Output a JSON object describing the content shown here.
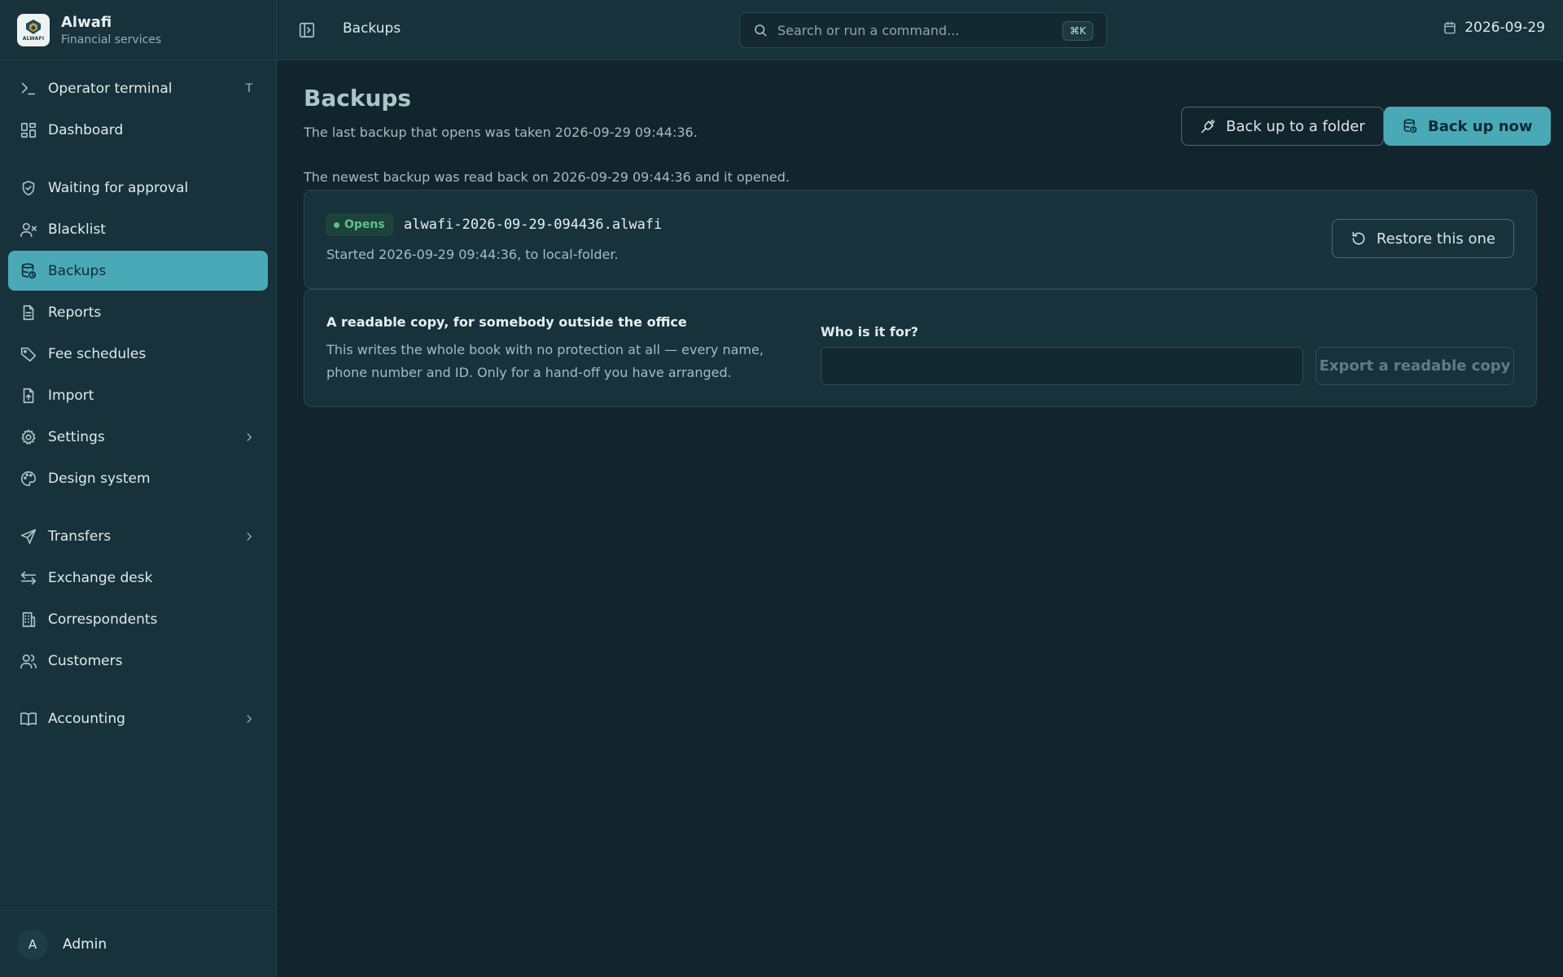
{
  "brand": {
    "name": "Alwafi",
    "subtitle": "Financial services",
    "logo_text": "ALWAFI"
  },
  "sidebar": {
    "groups": [
      [
        {
          "label": "Operator terminal",
          "icon": "terminal-icon",
          "shortcut": "T"
        },
        {
          "label": "Dashboard",
          "icon": "dashboard-icon"
        }
      ],
      [
        {
          "label": "Waiting for approval",
          "icon": "shield-check-icon"
        },
        {
          "label": "Blacklist",
          "icon": "user-x-icon"
        },
        {
          "label": "Backups",
          "icon": "database-backup-icon",
          "active": true
        },
        {
          "label": "Reports",
          "icon": "file-text-icon"
        },
        {
          "label": "Fee schedules",
          "icon": "tag-icon"
        },
        {
          "label": "Import",
          "icon": "file-upload-icon"
        },
        {
          "label": "Settings",
          "icon": "gear-icon",
          "chevron": true
        },
        {
          "label": "Design system",
          "icon": "palette-icon"
        }
      ],
      [
        {
          "label": "Transfers",
          "icon": "send-icon",
          "chevron": true
        },
        {
          "label": "Exchange desk",
          "icon": "arrows-exchange-icon"
        },
        {
          "label": "Correspondents",
          "icon": "building-icon"
        },
        {
          "label": "Customers",
          "icon": "users-icon"
        }
      ],
      [
        {
          "label": "Accounting",
          "icon": "book-icon",
          "chevron": true
        }
      ]
    ]
  },
  "user": {
    "initial": "A",
    "name": "Admin"
  },
  "topbar": {
    "breadcrumb": "Backups",
    "search_placeholder": "Search or run a command...",
    "search_shortcut": "⌘K",
    "date": "2026-09-29"
  },
  "page": {
    "title": "Backups",
    "subtitle": "The last backup that opens was taken 2026-09-29 09:44:36.",
    "folder_button": "Back up to a folder",
    "now_button": "Back up now",
    "verify_line": "The newest backup was read back on 2026-09-29 09:44:36 and it opened."
  },
  "backup": {
    "status": "Opens",
    "status_color": "#5fc08f",
    "filename": "alwafi-2026-09-29-094436.alwafi",
    "started": "Started 2026-09-29 09:44:36, to local-folder.",
    "restore_label": "Restore this one"
  },
  "export": {
    "title": "A readable copy, for somebody outside the office",
    "description": "This writes the whole book with no protection at all — every name, phone number and ID. Only for a hand-off you have arranged.",
    "recipient_label": "Who is it for?",
    "recipient_value": "",
    "button_label": "Export a readable copy"
  },
  "colors": {
    "accent": "#4aa9b7",
    "sidebar_bg": "#17323b",
    "main_bg": "#13252c",
    "success": "#5fc08f"
  }
}
